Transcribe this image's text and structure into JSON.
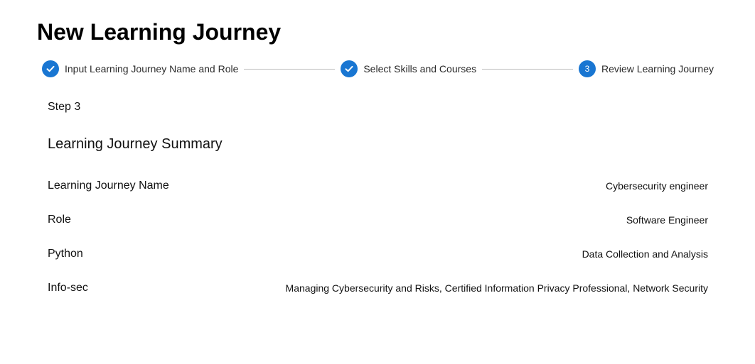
{
  "page": {
    "title": "New Learning Journey"
  },
  "stepper": {
    "steps": [
      {
        "label": "Input Learning Journey Name and Role",
        "status": "completed",
        "icon": "check-icon"
      },
      {
        "label": "Select Skills and Courses",
        "status": "completed",
        "icon": "check-icon"
      },
      {
        "label": "Review Learning Journey",
        "status": "active",
        "number": "3"
      }
    ],
    "accent_color": "#1976d2"
  },
  "content": {
    "step_caption": "Step 3",
    "summary_title": "Learning Journey Summary",
    "rows": [
      {
        "key": "Learning Journey Name",
        "value": "Cybersecurity engineer"
      },
      {
        "key": "Role",
        "value": "Software Engineer"
      },
      {
        "key": "Python",
        "value": "Data Collection and Analysis"
      },
      {
        "key": "Info-sec",
        "value": "Managing Cybersecurity and Risks, Certified Information Privacy Professional, Network Security"
      }
    ]
  }
}
